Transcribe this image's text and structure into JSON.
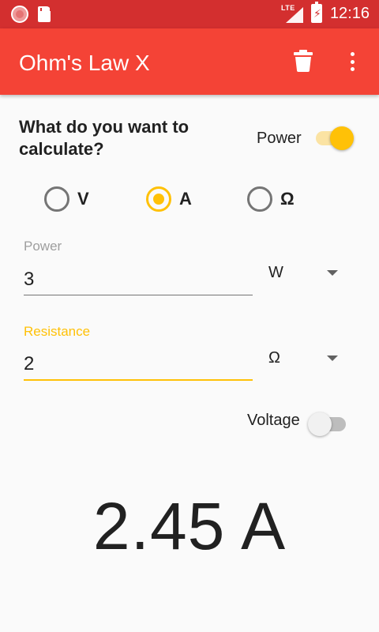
{
  "status_bar": {
    "network": "LTE",
    "time": "12:16",
    "icons": [
      "app-notification-icon",
      "sd-card-icon",
      "lte-signal-icon",
      "battery-charging-icon"
    ]
  },
  "app_bar": {
    "title": "Ohm's Law X",
    "actions": [
      "trash-icon",
      "more-vert-icon"
    ]
  },
  "calculator": {
    "question": "What do you want to calculate?",
    "power_toggle": {
      "label": "Power",
      "checked": true
    },
    "targets": [
      {
        "label": "V",
        "checked": false
      },
      {
        "label": "A",
        "checked": true
      },
      {
        "label": "Ω",
        "checked": false
      }
    ],
    "fields": {
      "power": {
        "label": "Power",
        "value": "3",
        "unit": "W"
      },
      "resistance": {
        "label": "Resistance",
        "value": "2",
        "unit": "Ω"
      }
    },
    "voltage_toggle": {
      "label": "Voltage",
      "checked": false
    },
    "result": "2.45 A"
  },
  "colors": {
    "status_bar": "#d32f2f",
    "app_bar": "#f44336",
    "accent": "#ffc107",
    "background": "#fafafa"
  }
}
